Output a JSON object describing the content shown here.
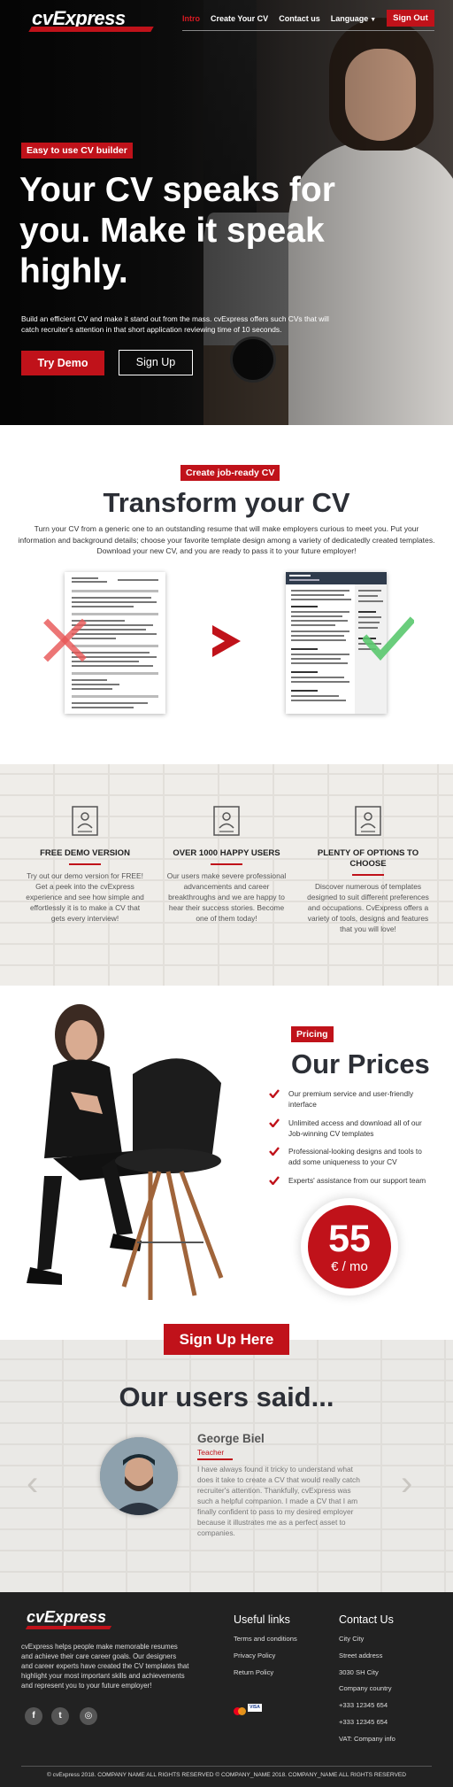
{
  "brand": "cvExpress",
  "nav": {
    "items": [
      {
        "label": "Intro",
        "active": true
      },
      {
        "label": "Create Your CV",
        "active": false
      },
      {
        "label": "Contact us",
        "active": false
      },
      {
        "label": "Language",
        "active": false
      }
    ],
    "signout": "Sign Out"
  },
  "hero": {
    "badge": "Easy to use CV builder",
    "title": "Your CV speaks for you. Make it speak highly.",
    "description": "Build an efficient CV and make it stand out from the mass. cvExpress offers such CVs that will catch recruiter's attention in that short application reviewing time of 10 seconds.",
    "try_demo": "Try Demo",
    "sign_up": "Sign Up"
  },
  "transform": {
    "tag": "Create job-ready CV",
    "title": "Transform your CV",
    "description": "Turn your CV from a generic one to an outstanding resume that will make employers curious to meet you. Put your information and background details; choose your favorite template design among a variety of dedicatedly created templates. Download your new CV, and you are ready to pass it to your future employer!",
    "new_cv_name": "Leo Ballo"
  },
  "features": [
    {
      "icon": "cv-document-icon",
      "title": "FREE DEMO VERSION",
      "description": "Try out our demo version for FREE! Get a peek into the cvExpress experience and see how simple and effortlessly it is to make a CV that gets every interview!"
    },
    {
      "icon": "cv-document-icon",
      "title": "OVER 1000 HAPPY USERS",
      "description": "Our users make severe professional advancements and career breakthroughs and we are happy to hear their success stories. Become one of them today!"
    },
    {
      "icon": "cv-document-icon",
      "title": "PLENTY OF OPTIONS TO CHOOSE",
      "description": "Discover numerous of templates designed to suit different preferences and occupations. CvExpress offers a variety of tools, designs and features that you will love!"
    }
  ],
  "pricing": {
    "tag": "Pricing",
    "title": "Our Prices",
    "items": [
      "Our premium service and user-friendly interface",
      "Unlimited access and download all of our Job-winning CV templates",
      "Professional-looking designs and tools to add some uniqueness to your CV",
      "Experts' assistance from our support team"
    ],
    "price": "55",
    "unit": "€ / mo"
  },
  "cta": {
    "sign_up_here": "Sign Up Here"
  },
  "testimonials": {
    "title": "Our users said...",
    "name": "George Biel",
    "role": "Teacher",
    "quote": "I have always found it tricky to understand what does it take to create a CV that would really catch recruiter's attention. Thankfully, cvExpress was such a helpful companion. I made a CV that I am finally confident to pass to my desired employer because it illustrates me as a perfect asset to companies."
  },
  "footer": {
    "about": "cvExpress helps people make memorable resumes and achieve their care career goals. Our designers and career experts have created the CV templates that highlight your most important skills and achievements and represent you to your future employer!",
    "social": [
      "facebook-icon",
      "twitter-icon",
      "instagram-icon"
    ],
    "useful_links_title": "Useful links",
    "useful_links": [
      "Terms and conditions",
      "Privacy Policy",
      "Return Policy"
    ],
    "contact_title": "Contact Us",
    "contact": [
      "City City",
      "Street address",
      "3030 SH City",
      "Company country",
      "+333 12345 654",
      "+333 12345 654",
      "VAT: Company info"
    ],
    "card_visa": "VISA",
    "copyright": "© cvExpress 2018. COMPANY NAME ALL RIGHTS RESERVED © COMPANY_NAME 2018. COMPANY_NAME ALL RIGHTS RESERVED"
  },
  "colors": {
    "accent": "#c0121a",
    "dark": "#222222",
    "heading": "#2c2f36"
  }
}
